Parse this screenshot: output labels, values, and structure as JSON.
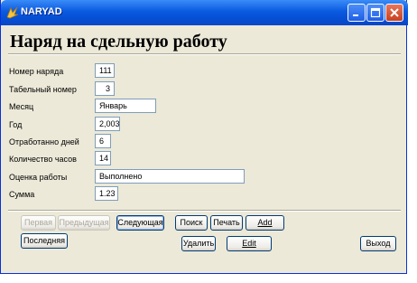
{
  "window": {
    "title": "NARYAD"
  },
  "heading": "Наряд на сдельную работу",
  "fields": {
    "order_number": {
      "label": "Номер наряда",
      "value": "111"
    },
    "tab_number": {
      "label": "Табельный номер",
      "value": "3"
    },
    "month": {
      "label": "Месяц",
      "value": "Январь"
    },
    "year": {
      "label": "Год",
      "value": "2,003"
    },
    "days_worked": {
      "label": "Отработанно дней",
      "value": "6"
    },
    "hours": {
      "label": "Количество часов",
      "value": "14"
    },
    "assessment": {
      "label": "Оценка работы",
      "value": "Выполнено"
    },
    "sum": {
      "label": "Сумма",
      "value": "1.23"
    }
  },
  "buttons": {
    "first": "Первая",
    "prev": "Предыдущая",
    "next": "Следующая",
    "last": "Последняя",
    "search": "Поиск",
    "print": "Печать",
    "add": "Add",
    "delete": "Удалить",
    "edit": "Edit",
    "exit": "Выход"
  },
  "colors": {
    "titlebar": "#0a5ae0",
    "window_bg": "#ece9d8",
    "close_button": "#c8401f"
  },
  "icons": [
    "app-icon",
    "minimize-icon",
    "maximize-icon",
    "close-icon"
  ]
}
